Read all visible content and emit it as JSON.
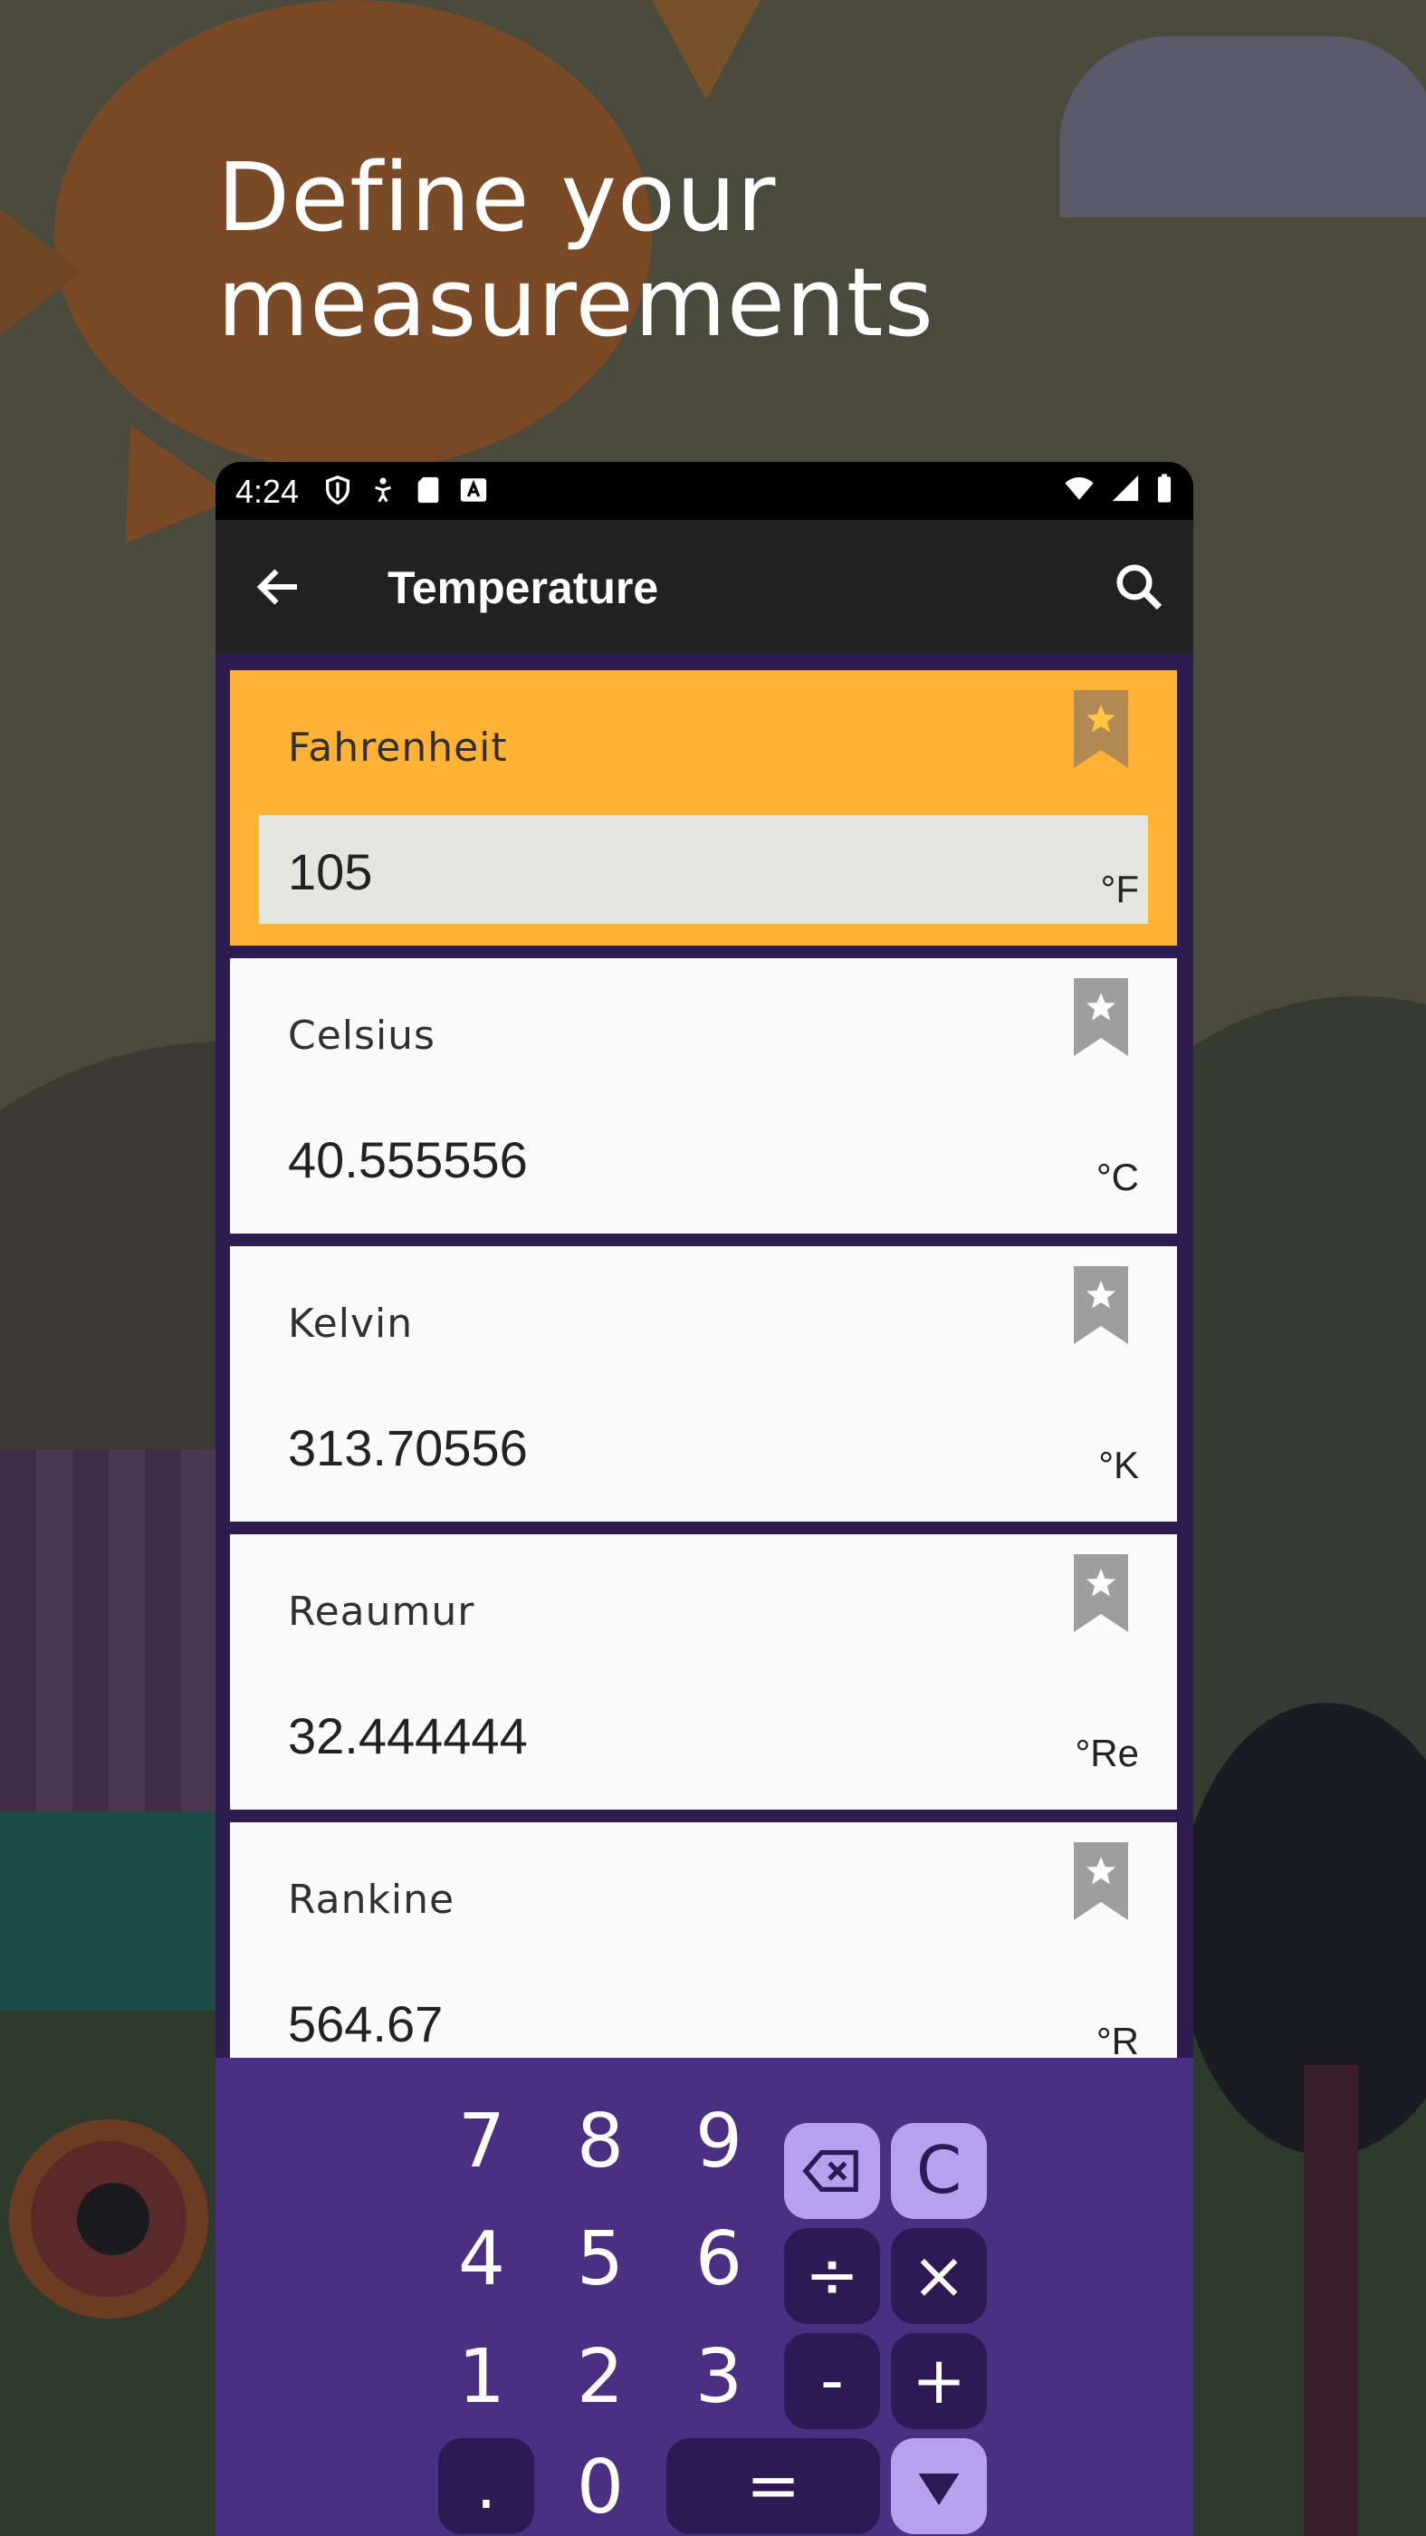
{
  "headline": {
    "line1": "Define your",
    "line2": "measurements"
  },
  "status_bar": {
    "time": "4:24",
    "left_icons": [
      "shield-icon",
      "accessibility-icon",
      "sd-card-icon",
      "keyboard-a-icon"
    ],
    "right_icons": [
      "wifi-icon",
      "cell-signal-icon",
      "battery-icon"
    ]
  },
  "app_bar": {
    "title": "Temperature",
    "back_icon": "arrow-left-icon",
    "search_icon": "search-icon"
  },
  "units": [
    {
      "name": "Fahrenheit",
      "value": "105",
      "symbol": "°F",
      "active": true,
      "favorite": false
    },
    {
      "name": "Celsius",
      "value": "40.555556",
      "symbol": "°C",
      "active": false,
      "favorite": false
    },
    {
      "name": "Kelvin",
      "value": "313.70556",
      "symbol": "°K",
      "active": false,
      "favorite": false
    },
    {
      "name": "Reaumur",
      "value": "32.444444",
      "symbol": "°Re",
      "active": false,
      "favorite": false
    },
    {
      "name": "Rankine",
      "value": "564.67",
      "symbol": "°R",
      "active": false,
      "favorite": false
    }
  ],
  "keypad": {
    "digits": [
      "7",
      "8",
      "9",
      "4",
      "5",
      "6",
      "1",
      "2",
      "3",
      ".",
      "0"
    ],
    "equals": "=",
    "clear": "C",
    "divide": "÷",
    "multiply": "×",
    "minus": "-",
    "plus": "+",
    "backspace_icon": "backspace-icon",
    "collapse_icon": "triangle-down-icon"
  },
  "colors": {
    "accent_active": "#ffb233",
    "keypad_bg": "#4b2f82",
    "keypad_op": "#2d1a55",
    "keypad_light": "#b9a0ef",
    "list_bg": "#2c1d4e",
    "app_bar": "#212121"
  }
}
